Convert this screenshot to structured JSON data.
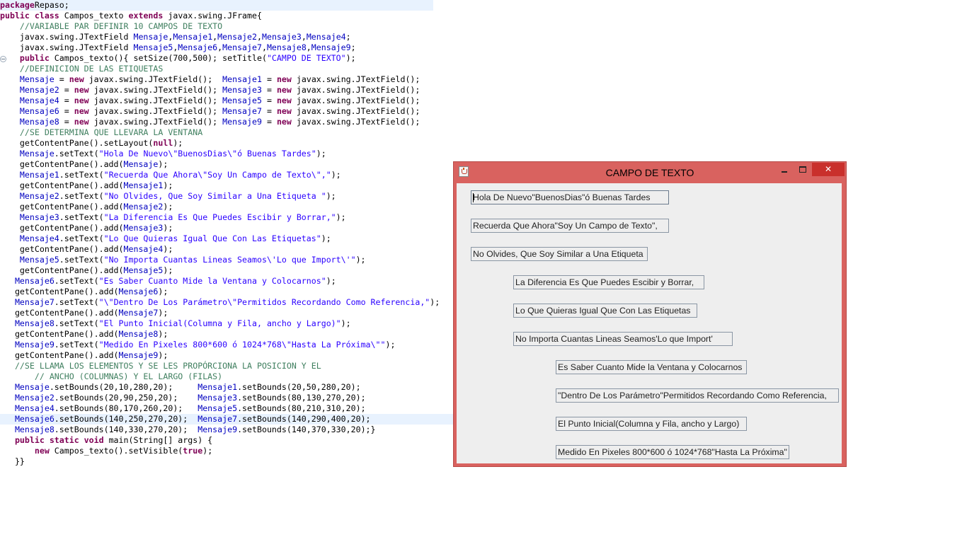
{
  "editor": {
    "lines": [
      {
        "segs": [
          [
            "kw",
            "package"
          ],
          [
            "",
            "Repaso;"
          ]
        ],
        "cls": "cur"
      },
      {
        "segs": [
          [
            "kw",
            "public class "
          ],
          [
            "",
            "Campos_texto "
          ],
          [
            "kw",
            "extends"
          ],
          [
            "",
            " javax.swing.JFrame{"
          ]
        ]
      },
      {
        "segs": [
          [
            "",
            "    "
          ],
          [
            "cm",
            "//VARIABLE PAR DEFINIR 10 CAMPOS DE TEXTO"
          ]
        ]
      },
      {
        "segs": [
          [
            "",
            "    javax.swing.JTextField "
          ],
          [
            "fld",
            "Mensaje"
          ],
          [
            "",
            ","
          ],
          [
            "fld",
            "Mensaje1"
          ],
          [
            "",
            ","
          ],
          [
            "fld",
            "Mensaje2"
          ],
          [
            "",
            ","
          ],
          [
            "fld",
            "Mensaje3"
          ],
          [
            "",
            ","
          ],
          [
            "fld",
            "Mensaje4"
          ],
          [
            "",
            ";"
          ]
        ]
      },
      {
        "segs": [
          [
            "",
            "    javax.swing.JTextField "
          ],
          [
            "fld",
            "Mensaje5"
          ],
          [
            "",
            ","
          ],
          [
            "fld",
            "Mensaje6"
          ],
          [
            "",
            ","
          ],
          [
            "fld",
            "Mensaje7"
          ],
          [
            "",
            ","
          ],
          [
            "fld",
            "Mensaje8"
          ],
          [
            "",
            ","
          ],
          [
            "fld",
            "Mensaje9"
          ],
          [
            "",
            ";"
          ]
        ]
      },
      {
        "segs": [
          [
            "",
            "    "
          ],
          [
            "kw",
            "public"
          ],
          [
            "",
            " Campos_texto(){ setSize(700,500); setTitle("
          ],
          [
            "st",
            "\"CAMPO DE TEXTO\""
          ],
          [
            "",
            ");"
          ]
        ]
      },
      {
        "segs": [
          [
            "",
            "    "
          ],
          [
            "cm",
            "//DEFINICION DE LAS ETIQUETAS"
          ]
        ]
      },
      {
        "segs": [
          [
            "",
            "    "
          ],
          [
            "fld",
            "Mensaje"
          ],
          [
            "",
            " = "
          ],
          [
            "kw",
            "new"
          ],
          [
            "",
            " javax.swing.JTextField();  "
          ],
          [
            "fld",
            "Mensaje1"
          ],
          [
            "",
            " = "
          ],
          [
            "kw",
            "new"
          ],
          [
            "",
            " javax.swing.JTextField();"
          ]
        ]
      },
      {
        "segs": [
          [
            "",
            "    "
          ],
          [
            "fld",
            "Mensaje2"
          ],
          [
            "",
            " = "
          ],
          [
            "kw",
            "new"
          ],
          [
            "",
            " javax.swing.JTextField(); "
          ],
          [
            "fld",
            "Mensaje3"
          ],
          [
            "",
            " = "
          ],
          [
            "kw",
            "new"
          ],
          [
            "",
            " javax.swing.JTextField();"
          ]
        ]
      },
      {
        "segs": [
          [
            "",
            "    "
          ],
          [
            "fld",
            "Mensaje4"
          ],
          [
            "",
            " = "
          ],
          [
            "kw",
            "new"
          ],
          [
            "",
            " javax.swing.JTextField(); "
          ],
          [
            "fld",
            "Mensaje5"
          ],
          [
            "",
            " = "
          ],
          [
            "kw",
            "new"
          ],
          [
            "",
            " javax.swing.JTextField();"
          ]
        ]
      },
      {
        "segs": [
          [
            "",
            "    "
          ],
          [
            "fld",
            "Mensaje6"
          ],
          [
            "",
            " = "
          ],
          [
            "kw",
            "new"
          ],
          [
            "",
            " javax.swing.JTextField(); "
          ],
          [
            "fld",
            "Mensaje7"
          ],
          [
            "",
            " = "
          ],
          [
            "kw",
            "new"
          ],
          [
            "",
            " javax.swing.JTextField();"
          ]
        ]
      },
      {
        "segs": [
          [
            "",
            "    "
          ],
          [
            "fld",
            "Mensaje8"
          ],
          [
            "",
            " = "
          ],
          [
            "kw",
            "new"
          ],
          [
            "",
            " javax.swing.JTextField(); "
          ],
          [
            "fld",
            "Mensaje9"
          ],
          [
            "",
            " = "
          ],
          [
            "kw",
            "new"
          ],
          [
            "",
            " javax.swing.JTextField();"
          ]
        ]
      },
      {
        "segs": [
          [
            "",
            "    "
          ],
          [
            "cm",
            "//SE DETERMINA QUE LLEVARA LA VENTANA"
          ]
        ]
      },
      {
        "segs": [
          [
            "",
            "    getContentPane().setLayout("
          ],
          [
            "kw",
            "null"
          ],
          [
            "",
            ");"
          ]
        ]
      },
      {
        "segs": [
          [
            "",
            "    "
          ],
          [
            "fld",
            "Mensaje"
          ],
          [
            "",
            ".setText("
          ],
          [
            "st",
            "\"Hola De Nuevo\\\"BuenosDias\\\"ó Buenas Tardes\""
          ],
          [
            "",
            ");"
          ]
        ]
      },
      {
        "segs": [
          [
            "",
            "    getContentPane().add("
          ],
          [
            "fld",
            "Mensaje"
          ],
          [
            "",
            ");"
          ]
        ]
      },
      {
        "segs": [
          [
            "",
            "    "
          ],
          [
            "fld",
            "Mensaje1"
          ],
          [
            "",
            ".setText("
          ],
          [
            "st",
            "\"Recuerda Que Ahora\\\"Soy Un Campo de Texto\\\",\""
          ],
          [
            "",
            ");"
          ]
        ]
      },
      {
        "segs": [
          [
            "",
            "    getContentPane().add("
          ],
          [
            "fld",
            "Mensaje1"
          ],
          [
            "",
            ");"
          ]
        ]
      },
      {
        "segs": [
          [
            "",
            "    "
          ],
          [
            "fld",
            "Mensaje2"
          ],
          [
            "",
            ".setText("
          ],
          [
            "st",
            "\"No Olvides, Que Soy Similar a Una Etiqueta \""
          ],
          [
            "",
            ");"
          ]
        ]
      },
      {
        "segs": [
          [
            "",
            "    getContentPane().add("
          ],
          [
            "fld",
            "Mensaje2"
          ],
          [
            "",
            ");"
          ]
        ]
      },
      {
        "segs": [
          [
            "",
            "    "
          ],
          [
            "fld",
            "Mensaje3"
          ],
          [
            "",
            ".setText("
          ],
          [
            "st",
            "\"La Diferencia Es Que Puedes Escibir y Borrar,\""
          ],
          [
            "",
            ");"
          ]
        ]
      },
      {
        "segs": [
          [
            "",
            "    getContentPane().add("
          ],
          [
            "fld",
            "Mensaje3"
          ],
          [
            "",
            ");"
          ]
        ]
      },
      {
        "segs": [
          [
            "",
            "    "
          ],
          [
            "fld",
            "Mensaje4"
          ],
          [
            "",
            ".setText("
          ],
          [
            "st",
            "\"Lo Que Quieras Igual Que Con Las Etiquetas\""
          ],
          [
            "",
            ");"
          ]
        ]
      },
      {
        "segs": [
          [
            "",
            "    getContentPane().add("
          ],
          [
            "fld",
            "Mensaje4"
          ],
          [
            "",
            ");"
          ]
        ]
      },
      {
        "segs": [
          [
            "",
            "    "
          ],
          [
            "fld",
            "Mensaje5"
          ],
          [
            "",
            ".setText("
          ],
          [
            "st",
            "\"No Importa Cuantas Lineas Seamos\\'Lo que Import\\'\""
          ],
          [
            "",
            ");"
          ]
        ]
      },
      {
        "segs": [
          [
            "",
            "    getContentPane().add("
          ],
          [
            "fld",
            "Mensaje5"
          ],
          [
            "",
            ");"
          ]
        ]
      },
      {
        "segs": [
          [
            "",
            "   "
          ],
          [
            "fld",
            "Mensaje6"
          ],
          [
            "",
            ".setText("
          ],
          [
            "st",
            "\"Es Saber Cuanto Mide la Ventana y Colocarnos\""
          ],
          [
            "",
            ");"
          ]
        ]
      },
      {
        "segs": [
          [
            "",
            "   getContentPane().add("
          ],
          [
            "fld",
            "Mensaje6"
          ],
          [
            "",
            ");"
          ]
        ]
      },
      {
        "segs": [
          [
            "",
            "   "
          ],
          [
            "fld",
            "Mensaje7"
          ],
          [
            "",
            ".setText("
          ],
          [
            "st",
            "\"\\\"Dentro De Los Parámetro\\\"Permitidos Recordando Como Referencia,\""
          ],
          [
            "",
            ");"
          ]
        ]
      },
      {
        "segs": [
          [
            "",
            "   getContentPane().add("
          ],
          [
            "fld",
            "Mensaje7"
          ],
          [
            "",
            ");"
          ]
        ]
      },
      {
        "segs": [
          [
            "",
            "   "
          ],
          [
            "fld",
            "Mensaje8"
          ],
          [
            "",
            ".setText("
          ],
          [
            "st",
            "\"El Punto Inicial(Columna y Fila, ancho y Largo)\""
          ],
          [
            "",
            ");"
          ]
        ]
      },
      {
        "segs": [
          [
            "",
            "   getContentPane().add("
          ],
          [
            "fld",
            "Mensaje8"
          ],
          [
            "",
            ");"
          ]
        ]
      },
      {
        "segs": [
          [
            "",
            "   "
          ],
          [
            "fld",
            "Mensaje9"
          ],
          [
            "",
            ".setText("
          ],
          [
            "st",
            "\"Medido En Pixeles 800*600 ó 1024*768\\\"Hasta La Próxima\\\"\""
          ],
          [
            "",
            ");"
          ]
        ]
      },
      {
        "segs": [
          [
            "",
            "   getContentPane().add("
          ],
          [
            "fld",
            "Mensaje9"
          ],
          [
            "",
            ");"
          ]
        ]
      },
      {
        "segs": [
          [
            "",
            "   "
          ],
          [
            "cm",
            "//SE LLAMA LOS ELEMENTOS Y SE LES PROPÓRCIONA LA POSICION Y EL"
          ]
        ]
      },
      {
        "segs": [
          [
            "",
            "       "
          ],
          [
            "cm",
            "// ANCHO (COLUMNAS) Y EL LARGO (FILAS)"
          ]
        ]
      },
      {
        "segs": [
          [
            "",
            "   "
          ],
          [
            "fld",
            "Mensaje"
          ],
          [
            "",
            ".setBounds(20,10,280,20);     "
          ],
          [
            "fld",
            "Mensaje1"
          ],
          [
            "",
            ".setBounds(20,50,280,20);"
          ]
        ]
      },
      {
        "segs": [
          [
            "",
            "   "
          ],
          [
            "fld",
            "Mensaje2"
          ],
          [
            "",
            ".setBounds(20,90,250,20);    "
          ],
          [
            "fld",
            "Mensaje3"
          ],
          [
            "",
            ".setBounds(80,130,270,20);"
          ]
        ]
      },
      {
        "segs": [
          [
            "",
            "   "
          ],
          [
            "fld",
            "Mensaje4"
          ],
          [
            "",
            ".setBounds(80,170,260,20);   "
          ],
          [
            "fld",
            "Mensaje5"
          ],
          [
            "",
            ".setBounds(80,210,310,20);"
          ]
        ]
      },
      {
        "segs": [
          [
            "",
            "   "
          ],
          [
            "fld",
            "Mensaje6"
          ],
          [
            "",
            ".setBounds(140,250,270,20);  "
          ],
          [
            "fld",
            "Mensaje7"
          ],
          [
            "",
            ".setBounds(140,290,400,20);"
          ]
        ],
        "cls": "sel"
      },
      {
        "segs": [
          [
            "",
            "   "
          ],
          [
            "fld",
            "Mensaje8"
          ],
          [
            "",
            ".setBounds(140,330,270,20);  "
          ],
          [
            "fld",
            "Mensaje9"
          ],
          [
            "",
            ".setBounds(140,370,330,20);}"
          ]
        ]
      },
      {
        "segs": [
          [
            "",
            "   "
          ],
          [
            "kw",
            "public static void"
          ],
          [
            "",
            " main(String[] args) {"
          ]
        ]
      },
      {
        "segs": [
          [
            "",
            "       "
          ],
          [
            "kw",
            "new"
          ],
          [
            "",
            " Campos_texto().setVisible("
          ],
          [
            "kw",
            "true"
          ],
          [
            "",
            ");"
          ]
        ]
      },
      {
        "segs": [
          [
            "",
            "   }}"
          ]
        ]
      }
    ]
  },
  "window": {
    "title": "CAMPO DE TEXTO",
    "close_glyph": "✕",
    "fields": [
      "Hola De Nuevo\"BuenosDias\"ó Buenas Tardes",
      "Recuerda Que Ahora\"Soy Un Campo de Texto\",",
      "No Olvides, Que Soy Similar a Una Etiqueta ",
      "La Diferencia Es Que Puedes Escibir y Borrar,",
      "Lo Que Quieras Igual Que Con Las Etiquetas",
      "No Importa Cuantas Lineas Seamos'Lo que Import'",
      "Es Saber Cuanto Mide la Ventana y Colocarnos",
      "\"Dentro De Los Parámetro\"Permitidos Recordando Como Referencia,",
      "El Punto Inicial(Columna y Fila, ancho y Largo)",
      "Medido En Pixeles 800*600 ó 1024*768\"Hasta La Próxima\""
    ]
  }
}
